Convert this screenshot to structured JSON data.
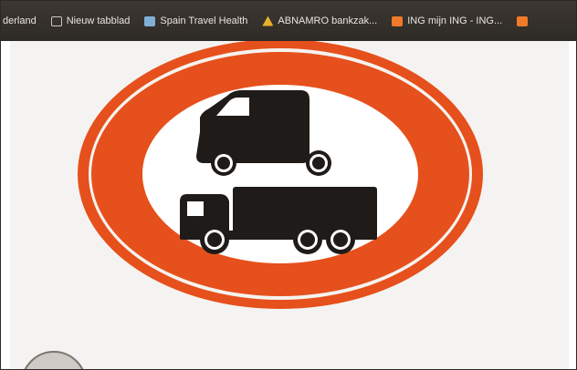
{
  "bookmarks_bar": {
    "items": [
      {
        "label": "derland",
        "icon": "none"
      },
      {
        "label": "Nieuw tabblad",
        "icon": "tab-icon"
      },
      {
        "label": "Spain Travel Health",
        "icon": "travel-icon"
      },
      {
        "label": "ABNAMRO bankzak...",
        "icon": "abnamro-icon"
      },
      {
        "label": "ING mijn ING - ING...",
        "icon": "ing-icon"
      }
    ],
    "colors": {
      "background": "#35302b",
      "text": "#e9e4de"
    }
  },
  "content": {
    "sign": {
      "type": "prohibition-sign",
      "meaning": "vans and trucks prohibited",
      "colors": {
        "outer_ring": "#e6501c",
        "inner_ring": "#e6501c",
        "gap": "#f6f3ef",
        "center": "#ffffff",
        "symbols": "#1f1b18"
      },
      "symbols": [
        "van-icon",
        "truck-icon"
      ]
    }
  }
}
